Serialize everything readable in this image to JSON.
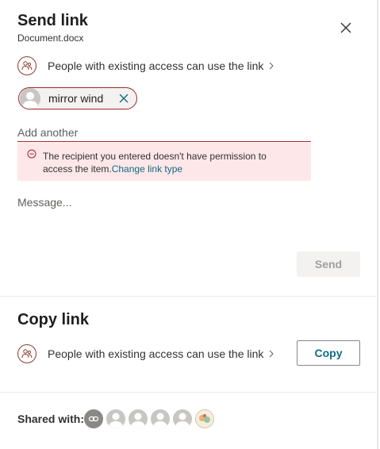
{
  "send_link": {
    "title": "Send link",
    "filename": "Document.docx",
    "access_label": "People with existing access can use the link",
    "recipient": {
      "name": "mirror wind"
    },
    "add_another_placeholder": "Add another",
    "error": {
      "message": "The recipient you entered doesn't have permission to access the item.",
      "link_text": "Change link type"
    },
    "message_placeholder": "Message...",
    "send_label": "Send"
  },
  "copy_link": {
    "title": "Copy link",
    "access_label": "People with existing access can use the link",
    "copy_label": "Copy"
  },
  "shared_with": {
    "label": "Shared with:",
    "avatars": [
      "link-icon",
      "person-icon",
      "person-icon",
      "person-icon",
      "person-icon",
      "photo-avatar"
    ]
  },
  "colors": {
    "error_border": "#a4262c",
    "error_bg": "#fde7e9",
    "link": "#0f6b85",
    "access_icon": "#8a3b2b"
  }
}
